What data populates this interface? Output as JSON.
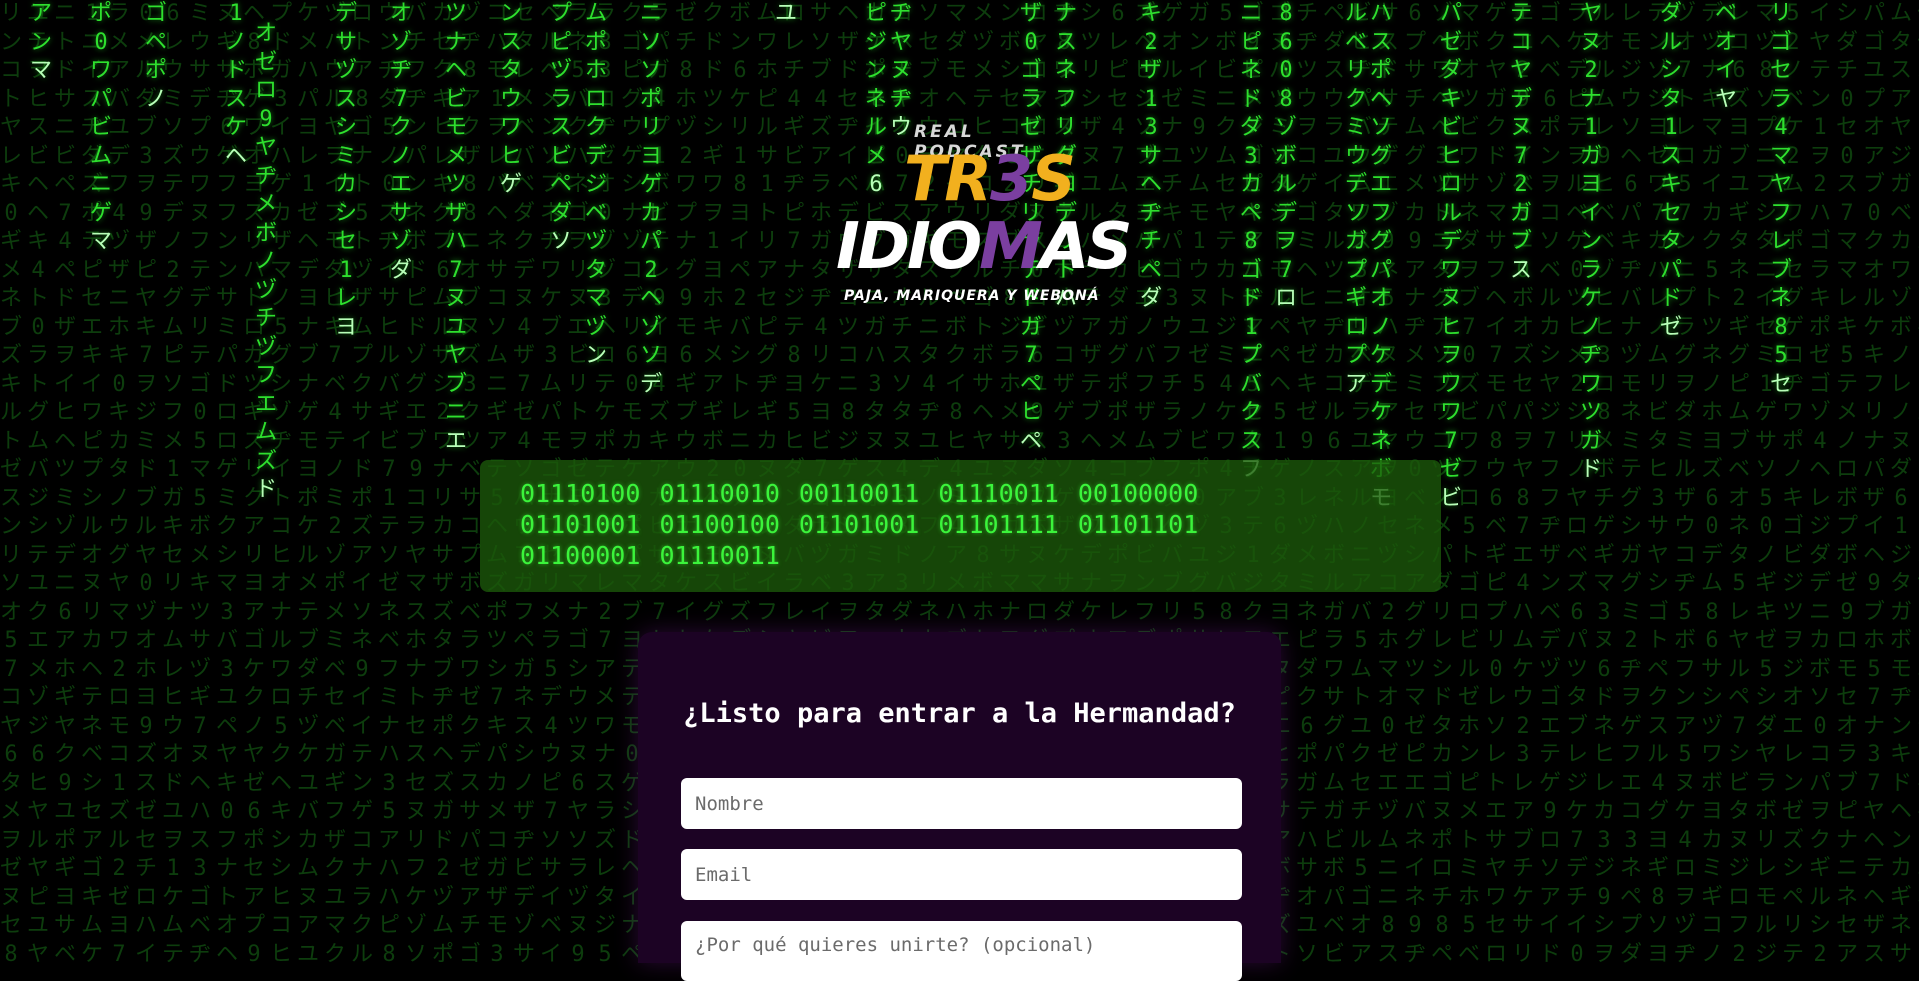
{
  "logo": {
    "subtitle": "REAL PODCAST",
    "line1_a": "TR",
    "line1_b": "3",
    "line1_c": "S",
    "line2_a": "IDIO",
    "line2_b": "M",
    "line2_c": "AS",
    "tagline": "PAJA, MARIQUERA Y WEBONÁ"
  },
  "binary_message": "01110100 01110010 00110011 01110011 00100000\n01101001 01100100 01101001 01101111 01101101\n01100001 01110011",
  "form": {
    "title": "¿Listo para entrar a la Hermandad?",
    "name_placeholder": "Nombre",
    "email_placeholder": "Email",
    "reason_placeholder": "¿Por qué quieres unirte? (opcional)"
  },
  "colors": {
    "rain": "#2ee02e",
    "binary_box": "#1c5a0a",
    "card": "#1c0324",
    "logo_yellow": "#f2b01e",
    "logo_purple": "#7b3fa0"
  }
}
